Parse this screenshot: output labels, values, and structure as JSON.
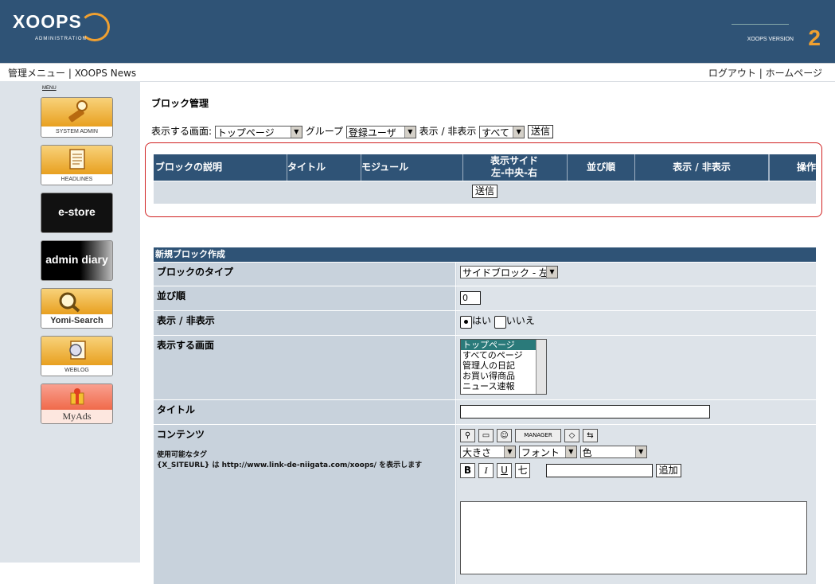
{
  "header": {
    "logo_text": "XOOPS",
    "logo_sub": "ADMINISTRATION",
    "version_label": "XOOPS VERSION",
    "version_number": "2",
    "colors": {
      "bar": "#2f5376",
      "accent": "#f0a030"
    }
  },
  "nav": {
    "menu": "管理メニュー",
    "sep": "|",
    "module": "XOOPS News",
    "logout": "ログアウト",
    "home": "ホームページ"
  },
  "sidebar": {
    "menu_label": "MENU",
    "items": [
      {
        "label": "SYSTEM ADMIN",
        "icon": "tools-icon"
      },
      {
        "label": "HEADLINES",
        "icon": "document-icon"
      },
      {
        "label": "e-store",
        "icon": ""
      },
      {
        "label": "admin diary",
        "icon": ""
      },
      {
        "label": "Yomi-Search",
        "icon": "magnifier-icon"
      },
      {
        "label": "WEBLOG",
        "icon": "weblog-icon"
      },
      {
        "label": "MyAds",
        "icon": "gift-icon"
      }
    ]
  },
  "page": {
    "title": "ブロック管理",
    "filter": {
      "screen_label": "表示する画面:",
      "screen_value": "トップページ",
      "group_label": "グループ",
      "group_value": "登録ユーザ",
      "visible_label": "表示 / 非表示",
      "visible_value": "すべて",
      "submit": "送信"
    },
    "block_table": {
      "headers": [
        "ブロックの説明",
        "タイトル",
        "モジュール",
        "表示サイド",
        "左-中央-右",
        "並び順",
        "表示 / 非表示",
        "操作"
      ],
      "submit": "送信"
    }
  },
  "form": {
    "heading": "新規ブロック作成",
    "block_type_label": "ブロックのタイプ",
    "block_type_value": "サイドブロック - 左",
    "order_label": "並び順",
    "order_value": "0",
    "visible_label": "表示 / 非表示",
    "yes": "はい",
    "no": "いいえ",
    "screen_label": "表示する画面",
    "screen_options": [
      "トップページ",
      "すべてのページ",
      "管理人の日記",
      "お買い得商品",
      "ニュース速報"
    ],
    "title_label": "タイトル",
    "content_label": "コンテンツ",
    "tags_label": "使用可能なタグ",
    "tags_help": "{X_SITEURL} は http://www.link-de-niigata.com/xoops/ を表示します",
    "manager_label": "MANAGER",
    "size_select": "大きさ",
    "font_select": "フォント",
    "color_select": "色",
    "bold": "B",
    "italic": "I",
    "underline": "U",
    "strike": "七",
    "add_button": "追加"
  }
}
